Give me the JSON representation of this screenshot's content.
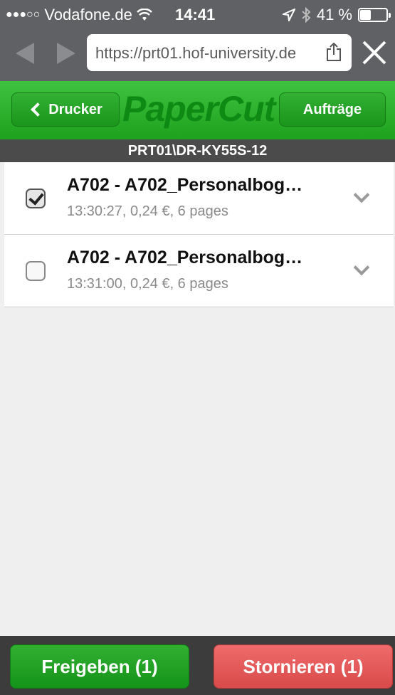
{
  "status_bar": {
    "signal": "●●●○○",
    "carrier": "Vodafone.de",
    "time": "14:41",
    "battery_text": "41 %",
    "battery_level": 0.41
  },
  "browser": {
    "url": "https://prt01.hof-university.de"
  },
  "header": {
    "logo": "PaperCut",
    "back_label": "Drucker",
    "jobs_label": "Aufträge",
    "printer_name": "PRT01\\DR-KY55S-12"
  },
  "jobs": [
    {
      "title": "A702 - A702_Personalbog…",
      "meta": "13:30:27, 0,24 €, 6 pages",
      "checked": true
    },
    {
      "title": "A702 - A702_Personalbog…",
      "meta": "13:31:00, 0,24 €, 6 pages",
      "checked": false
    }
  ],
  "footer": {
    "release_label": "Freigeben (1)",
    "cancel_label": "Stornieren (1)"
  },
  "colors": {
    "brand_green": "#1ea21e",
    "cancel_red": "#d94a4a"
  }
}
